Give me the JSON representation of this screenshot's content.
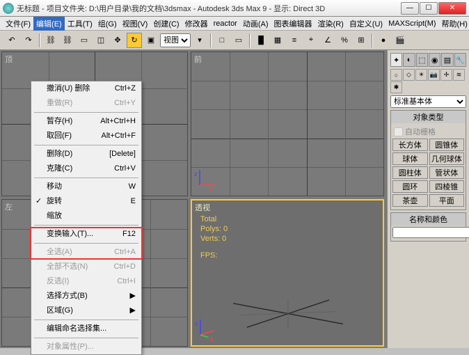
{
  "title": "无标题 - 项目文件夹: D:\\用户目录\\我的文档\\3dsmax - Autodesk 3ds Max 9 - 显示: Direct 3D",
  "menubar": [
    "文件(F)",
    "编辑(E)",
    "工具(T)",
    "组(G)",
    "视图(V)",
    "创建(C)",
    "修改器",
    "reactor",
    "动画(A)",
    "图表编辑器",
    "渲染(R)",
    "自定义(U)",
    "MAXScript(M)",
    "帮助(H)"
  ],
  "active_menu_index": 1,
  "dropdown": {
    "items": [
      {
        "label": "撤消(U) 删除",
        "shortcut": "Ctrl+Z",
        "disabled": false
      },
      {
        "label": "重做(R)",
        "shortcut": "Ctrl+Y",
        "disabled": true
      },
      {
        "sep": true
      },
      {
        "label": "暂存(H)",
        "shortcut": "Alt+Ctrl+H",
        "disabled": false
      },
      {
        "label": "取回(F)",
        "shortcut": "Alt+Ctrl+F",
        "disabled": false
      },
      {
        "sep": true
      },
      {
        "label": "删除(D)",
        "shortcut": "[Delete]",
        "disabled": false
      },
      {
        "label": "克隆(C)",
        "shortcut": "Ctrl+V",
        "disabled": false
      },
      {
        "sep": true
      },
      {
        "label": "移动",
        "shortcut": "W",
        "disabled": false
      },
      {
        "label": "旋转",
        "shortcut": "E",
        "disabled": false,
        "checked": true
      },
      {
        "label": "缩放",
        "shortcut": "",
        "disabled": false
      },
      {
        "sep": true
      },
      {
        "label": "变换输入(T)...",
        "shortcut": "F12",
        "disabled": false
      },
      {
        "sep": true
      },
      {
        "label": "全选(A)",
        "shortcut": "Ctrl+A",
        "disabled": true
      },
      {
        "label": "全部不选(N)",
        "shortcut": "Ctrl+D",
        "disabled": true
      },
      {
        "label": "反选(I)",
        "shortcut": "Ctrl+I",
        "disabled": true
      },
      {
        "label": "选择方式(B)",
        "shortcut": "▶",
        "disabled": false
      },
      {
        "label": "区域(G)",
        "shortcut": "▶",
        "disabled": false
      },
      {
        "sep": true
      },
      {
        "label": "编辑命名选择集...",
        "shortcut": "",
        "disabled": false
      },
      {
        "sep": true
      },
      {
        "label": "对象属性(P)...",
        "shortcut": "",
        "disabled": true
      }
    ],
    "highlight_from": 9,
    "highlight_to": 10
  },
  "toolbar_select": "视图",
  "viewports": {
    "tl_label": "顶",
    "tr_label": "前",
    "bl_label": "左",
    "br_label": "透视"
  },
  "stats": {
    "total": "Total",
    "polys": "Polys: 0",
    "verts": "Verts: 0",
    "fps": "FPS:"
  },
  "sidepanel": {
    "dropdown": "标准基本体",
    "group1_title": "对象类型",
    "autogrid": "自动栅格",
    "buttons": [
      [
        "长方体",
        "圆锥体"
      ],
      [
        "球体",
        "几何球体"
      ],
      [
        "圆柱体",
        "管状体"
      ],
      [
        "圆环",
        "四棱锥"
      ],
      [
        "茶壶",
        "平面"
      ]
    ],
    "group2_title": "名称和颜色"
  }
}
